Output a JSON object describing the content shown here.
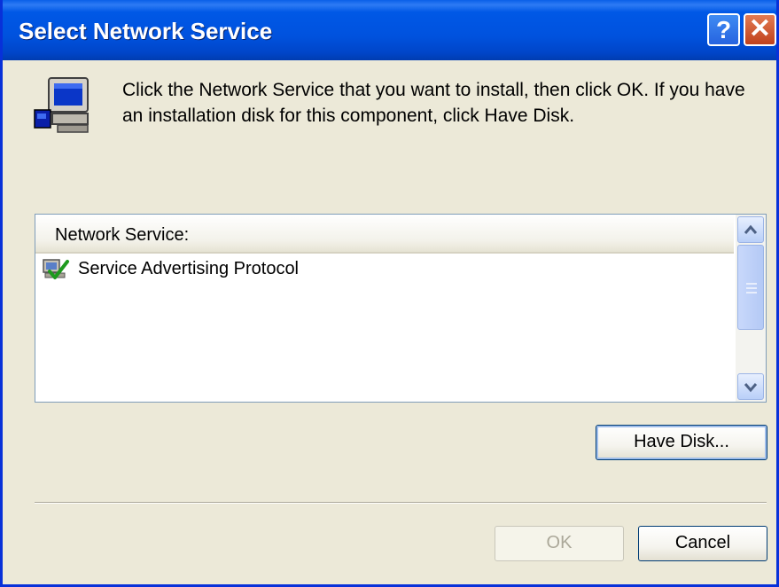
{
  "window": {
    "title": "Select Network Service",
    "help_glyph": "?",
    "close_glyph": "✕"
  },
  "instructions": "Click the Network Service that you want to install, then click OK. If you have an installation disk for this component, click Have Disk.",
  "list": {
    "header": "Network Service:",
    "items": [
      {
        "label": "Service Advertising Protocol",
        "icon": "network-service-icon"
      }
    ]
  },
  "buttons": {
    "have_disk": "Have Disk...",
    "ok": "OK",
    "cancel": "Cancel"
  },
  "colors": {
    "titlebar": "#0054E3",
    "dialog_bg": "#ECE9D8",
    "close_button": "#C0421C",
    "list_border": "#7F9DB9"
  }
}
